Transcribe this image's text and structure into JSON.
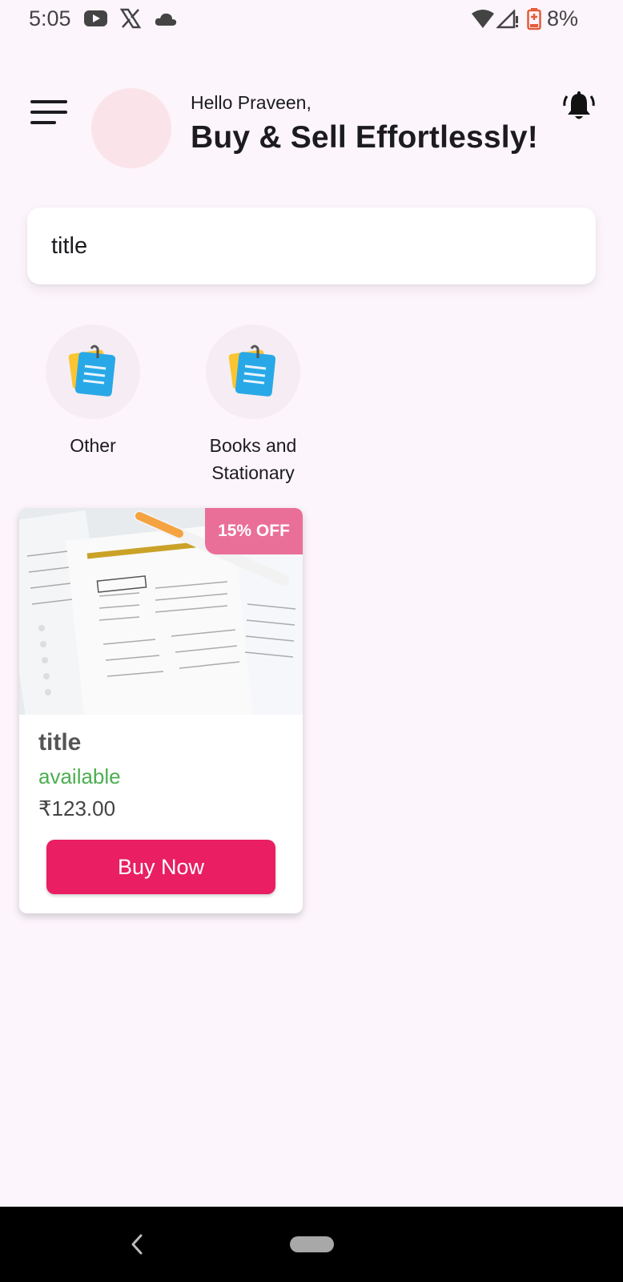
{
  "status_bar": {
    "time": "5:05",
    "battery": "8%",
    "icons": [
      "youtube-icon",
      "x-icon",
      "cloud-icon",
      "wifi-icon",
      "signal-icon",
      "battery-icon"
    ]
  },
  "header": {
    "greeting": "Hello Praveen,",
    "headline": "Buy & Sell Effortlessly!"
  },
  "search": {
    "value": "title"
  },
  "categories": [
    {
      "label": "Other",
      "icon": "notepad-icon"
    },
    {
      "label": "Books and Stationary",
      "icon": "notepad-icon"
    }
  ],
  "products": [
    {
      "discount": "15% OFF",
      "title": "title",
      "status": "available",
      "price": "₹123.00",
      "button_label": "Buy Now"
    }
  ],
  "colors": {
    "background": "#fdf5fc",
    "accent": "#e91e63",
    "badge": "#ea6f98",
    "available": "#4caf50"
  }
}
